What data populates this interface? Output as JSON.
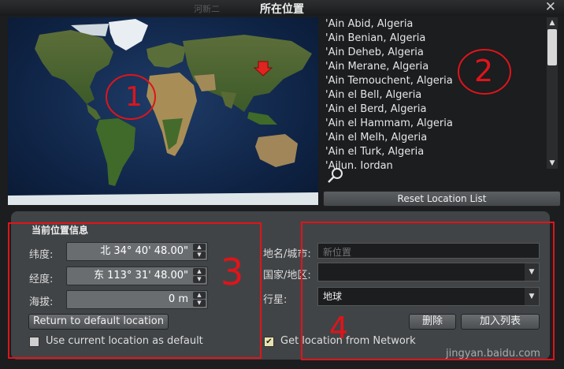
{
  "window": {
    "ghost_title": "河新二",
    "title": "所在位置",
    "close_glyph": "✕"
  },
  "location_list": {
    "items": [
      "'Ain Abid, Algeria",
      "'Ain Benian, Algeria",
      "'Ain Deheb, Algeria",
      "'Ain Merane, Algeria",
      "'Ain Temouchent, Algeria",
      "'Ain el Bell, Algeria",
      "'Ain el Berd, Algeria",
      "'Ain el Hammam, Algeria",
      "'Ain el Melh, Algeria",
      "'Ain el Turk, Algeria",
      "'Ajlun, Jordan"
    ],
    "reset_label": "Reset Location List"
  },
  "current": {
    "section_title": "当前位置信息",
    "latitude_label": "纬度:",
    "latitude_value": "北 34° 40' 48.00\"",
    "longitude_label": "经度:",
    "longitude_value": "东 113° 31' 48.00\"",
    "altitude_label": "海拔:",
    "altitude_value": "0 m",
    "return_default_label": "Return to default location",
    "use_current_label": "Use current location as default"
  },
  "edit": {
    "name_label": "地名/城市:",
    "name_placeholder": "新位置",
    "country_label": "国家/地区:",
    "country_value": "",
    "planet_label": "行星:",
    "planet_value": "地球",
    "delete_label": "删除",
    "add_label": "加入列表",
    "network_label": "Get location from Network"
  },
  "annotations": {
    "n1": "1",
    "n2": "2",
    "n3": "3",
    "n4": "4",
    "color": "#e0141a"
  },
  "watermark": "jingyan.baidu.com"
}
